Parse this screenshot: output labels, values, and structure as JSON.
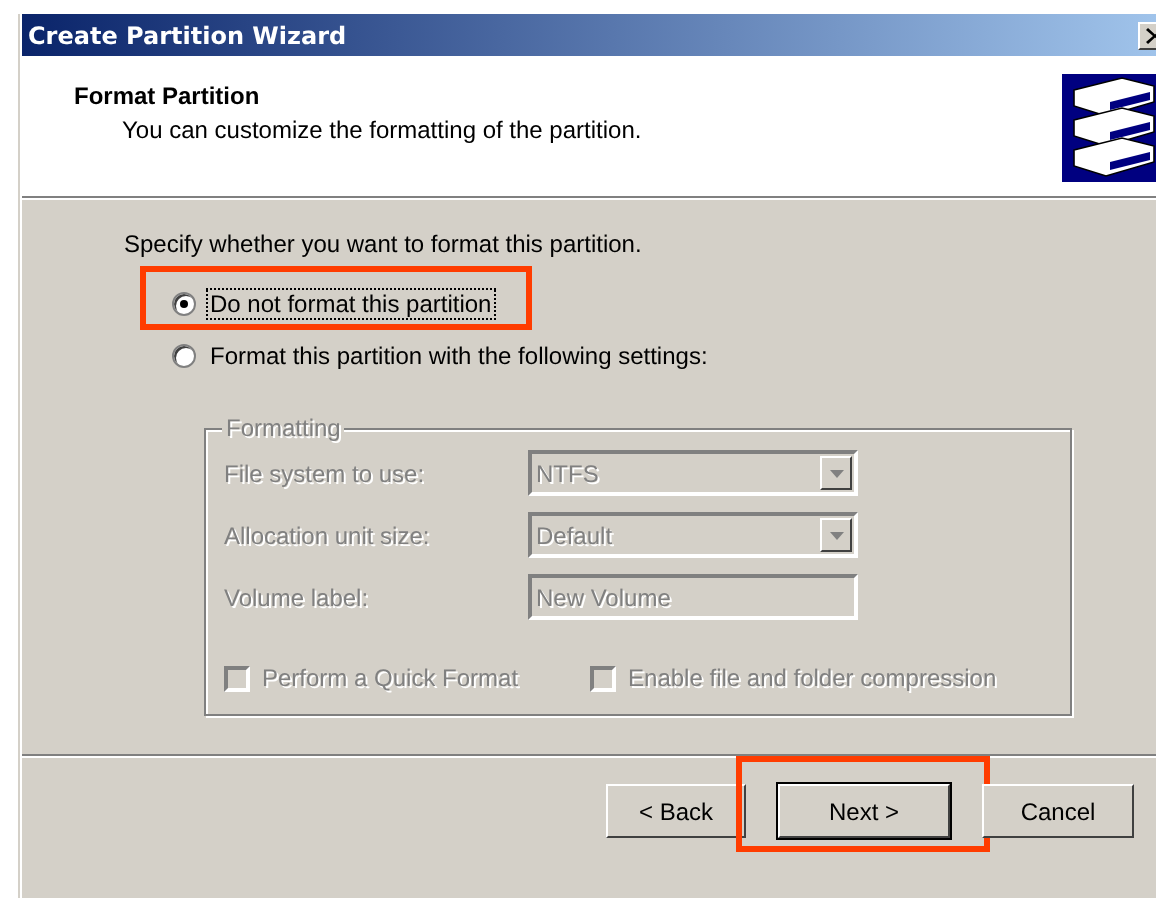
{
  "window": {
    "title": "Create Partition Wizard"
  },
  "header": {
    "title": "Format Partition",
    "subtitle": "You can customize the formatting of the partition."
  },
  "prompt": "Specify whether you want to format this partition.",
  "options": [
    {
      "label": "Do not format this partition",
      "selected": true,
      "focused": true,
      "highlighted": true
    },
    {
      "label": "Format this partition with the following settings:",
      "selected": false,
      "focused": false,
      "highlighted": false
    }
  ],
  "formatting": {
    "title": "Formatting",
    "disabled": true,
    "fields": [
      {
        "kind": "dropdown",
        "label": "File system to use:",
        "value": "NTFS"
      },
      {
        "kind": "dropdown",
        "label": "Allocation unit size:",
        "value": "Default"
      },
      {
        "kind": "text",
        "label": "Volume label:",
        "value": "New Volume"
      }
    ],
    "checkboxes": [
      {
        "label": "Perform a Quick Format",
        "checked": false
      },
      {
        "label": "Enable file and folder compression",
        "checked": false
      }
    ]
  },
  "buttons": [
    {
      "label": "< Back",
      "default": false,
      "highlighted": false
    },
    {
      "label": "Next >",
      "default": true,
      "highlighted": true
    },
    {
      "label": "Cancel",
      "default": false,
      "highlighted": false
    }
  ]
}
